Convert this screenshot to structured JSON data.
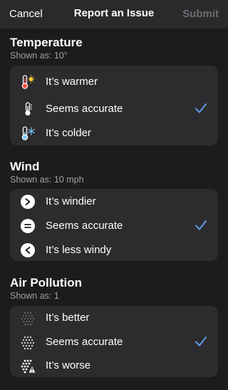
{
  "nav": {
    "cancel": "Cancel",
    "title": "Report an Issue",
    "submit": "Submit"
  },
  "accent": "#5e9ce8",
  "sections": [
    {
      "title": "Temperature",
      "shown_as": "Shown as: 10°",
      "options": [
        {
          "label": "It’s warmer",
          "icon": "thermometer-sun-icon"
        },
        {
          "label": "Seems accurate",
          "icon": "thermometer-icon",
          "selected": true
        },
        {
          "label": "It’s colder",
          "icon": "thermometer-snowflake-icon"
        }
      ]
    },
    {
      "title": "Wind",
      "shown_as": "Shown as: 10 mph",
      "options": [
        {
          "label": "It’s windier",
          "icon": "greater-than-circle-icon"
        },
        {
          "label": "Seems accurate",
          "icon": "equals-circle-icon",
          "selected": true
        },
        {
          "label": "It’s less windy",
          "icon": "less-than-circle-icon"
        }
      ]
    },
    {
      "title": "Air Pollution",
      "shown_as": "Shown as: 1",
      "options": [
        {
          "label": "It’s better",
          "icon": "dots-sparse-icon"
        },
        {
          "label": "Seems accurate",
          "icon": "dots-dense-icon",
          "selected": true
        },
        {
          "label": "It’s worse",
          "icon": "dots-warning-icon"
        }
      ]
    }
  ]
}
